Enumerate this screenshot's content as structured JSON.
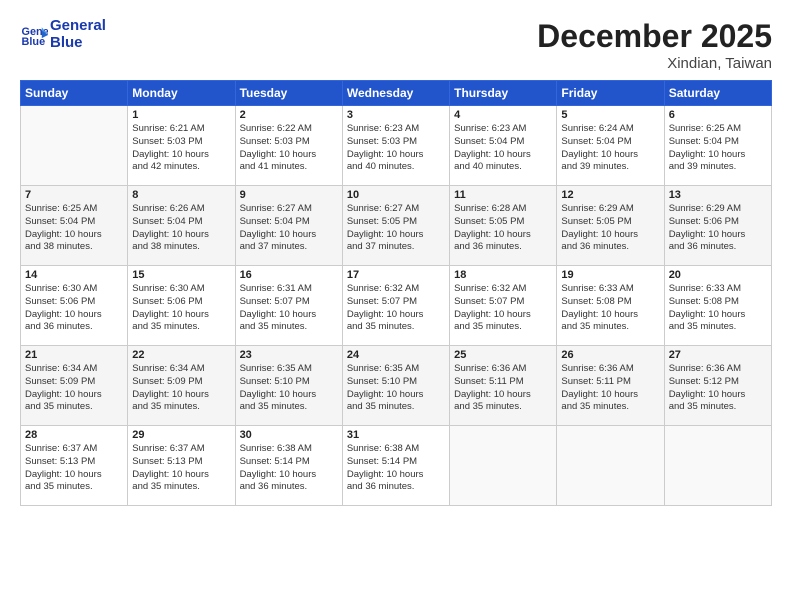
{
  "header": {
    "logo_line1": "General",
    "logo_line2": "Blue",
    "title": "December 2025",
    "location": "Xindian, Taiwan"
  },
  "days_of_week": [
    "Sunday",
    "Monday",
    "Tuesday",
    "Wednesday",
    "Thursday",
    "Friday",
    "Saturday"
  ],
  "weeks": [
    [
      {
        "day": "",
        "info": ""
      },
      {
        "day": "1",
        "info": "Sunrise: 6:21 AM\nSunset: 5:03 PM\nDaylight: 10 hours\nand 42 minutes."
      },
      {
        "day": "2",
        "info": "Sunrise: 6:22 AM\nSunset: 5:03 PM\nDaylight: 10 hours\nand 41 minutes."
      },
      {
        "day": "3",
        "info": "Sunrise: 6:23 AM\nSunset: 5:03 PM\nDaylight: 10 hours\nand 40 minutes."
      },
      {
        "day": "4",
        "info": "Sunrise: 6:23 AM\nSunset: 5:04 PM\nDaylight: 10 hours\nand 40 minutes."
      },
      {
        "day": "5",
        "info": "Sunrise: 6:24 AM\nSunset: 5:04 PM\nDaylight: 10 hours\nand 39 minutes."
      },
      {
        "day": "6",
        "info": "Sunrise: 6:25 AM\nSunset: 5:04 PM\nDaylight: 10 hours\nand 39 minutes."
      }
    ],
    [
      {
        "day": "7",
        "info": "Sunrise: 6:25 AM\nSunset: 5:04 PM\nDaylight: 10 hours\nand 38 minutes."
      },
      {
        "day": "8",
        "info": "Sunrise: 6:26 AM\nSunset: 5:04 PM\nDaylight: 10 hours\nand 38 minutes."
      },
      {
        "day": "9",
        "info": "Sunrise: 6:27 AM\nSunset: 5:04 PM\nDaylight: 10 hours\nand 37 minutes."
      },
      {
        "day": "10",
        "info": "Sunrise: 6:27 AM\nSunset: 5:05 PM\nDaylight: 10 hours\nand 37 minutes."
      },
      {
        "day": "11",
        "info": "Sunrise: 6:28 AM\nSunset: 5:05 PM\nDaylight: 10 hours\nand 36 minutes."
      },
      {
        "day": "12",
        "info": "Sunrise: 6:29 AM\nSunset: 5:05 PM\nDaylight: 10 hours\nand 36 minutes."
      },
      {
        "day": "13",
        "info": "Sunrise: 6:29 AM\nSunset: 5:06 PM\nDaylight: 10 hours\nand 36 minutes."
      }
    ],
    [
      {
        "day": "14",
        "info": "Sunrise: 6:30 AM\nSunset: 5:06 PM\nDaylight: 10 hours\nand 36 minutes."
      },
      {
        "day": "15",
        "info": "Sunrise: 6:30 AM\nSunset: 5:06 PM\nDaylight: 10 hours\nand 35 minutes."
      },
      {
        "day": "16",
        "info": "Sunrise: 6:31 AM\nSunset: 5:07 PM\nDaylight: 10 hours\nand 35 minutes."
      },
      {
        "day": "17",
        "info": "Sunrise: 6:32 AM\nSunset: 5:07 PM\nDaylight: 10 hours\nand 35 minutes."
      },
      {
        "day": "18",
        "info": "Sunrise: 6:32 AM\nSunset: 5:07 PM\nDaylight: 10 hours\nand 35 minutes."
      },
      {
        "day": "19",
        "info": "Sunrise: 6:33 AM\nSunset: 5:08 PM\nDaylight: 10 hours\nand 35 minutes."
      },
      {
        "day": "20",
        "info": "Sunrise: 6:33 AM\nSunset: 5:08 PM\nDaylight: 10 hours\nand 35 minutes."
      }
    ],
    [
      {
        "day": "21",
        "info": "Sunrise: 6:34 AM\nSunset: 5:09 PM\nDaylight: 10 hours\nand 35 minutes."
      },
      {
        "day": "22",
        "info": "Sunrise: 6:34 AM\nSunset: 5:09 PM\nDaylight: 10 hours\nand 35 minutes."
      },
      {
        "day": "23",
        "info": "Sunrise: 6:35 AM\nSunset: 5:10 PM\nDaylight: 10 hours\nand 35 minutes."
      },
      {
        "day": "24",
        "info": "Sunrise: 6:35 AM\nSunset: 5:10 PM\nDaylight: 10 hours\nand 35 minutes."
      },
      {
        "day": "25",
        "info": "Sunrise: 6:36 AM\nSunset: 5:11 PM\nDaylight: 10 hours\nand 35 minutes."
      },
      {
        "day": "26",
        "info": "Sunrise: 6:36 AM\nSunset: 5:11 PM\nDaylight: 10 hours\nand 35 minutes."
      },
      {
        "day": "27",
        "info": "Sunrise: 6:36 AM\nSunset: 5:12 PM\nDaylight: 10 hours\nand 35 minutes."
      }
    ],
    [
      {
        "day": "28",
        "info": "Sunrise: 6:37 AM\nSunset: 5:13 PM\nDaylight: 10 hours\nand 35 minutes."
      },
      {
        "day": "29",
        "info": "Sunrise: 6:37 AM\nSunset: 5:13 PM\nDaylight: 10 hours\nand 35 minutes."
      },
      {
        "day": "30",
        "info": "Sunrise: 6:38 AM\nSunset: 5:14 PM\nDaylight: 10 hours\nand 36 minutes."
      },
      {
        "day": "31",
        "info": "Sunrise: 6:38 AM\nSunset: 5:14 PM\nDaylight: 10 hours\nand 36 minutes."
      },
      {
        "day": "",
        "info": ""
      },
      {
        "day": "",
        "info": ""
      },
      {
        "day": "",
        "info": ""
      }
    ]
  ]
}
